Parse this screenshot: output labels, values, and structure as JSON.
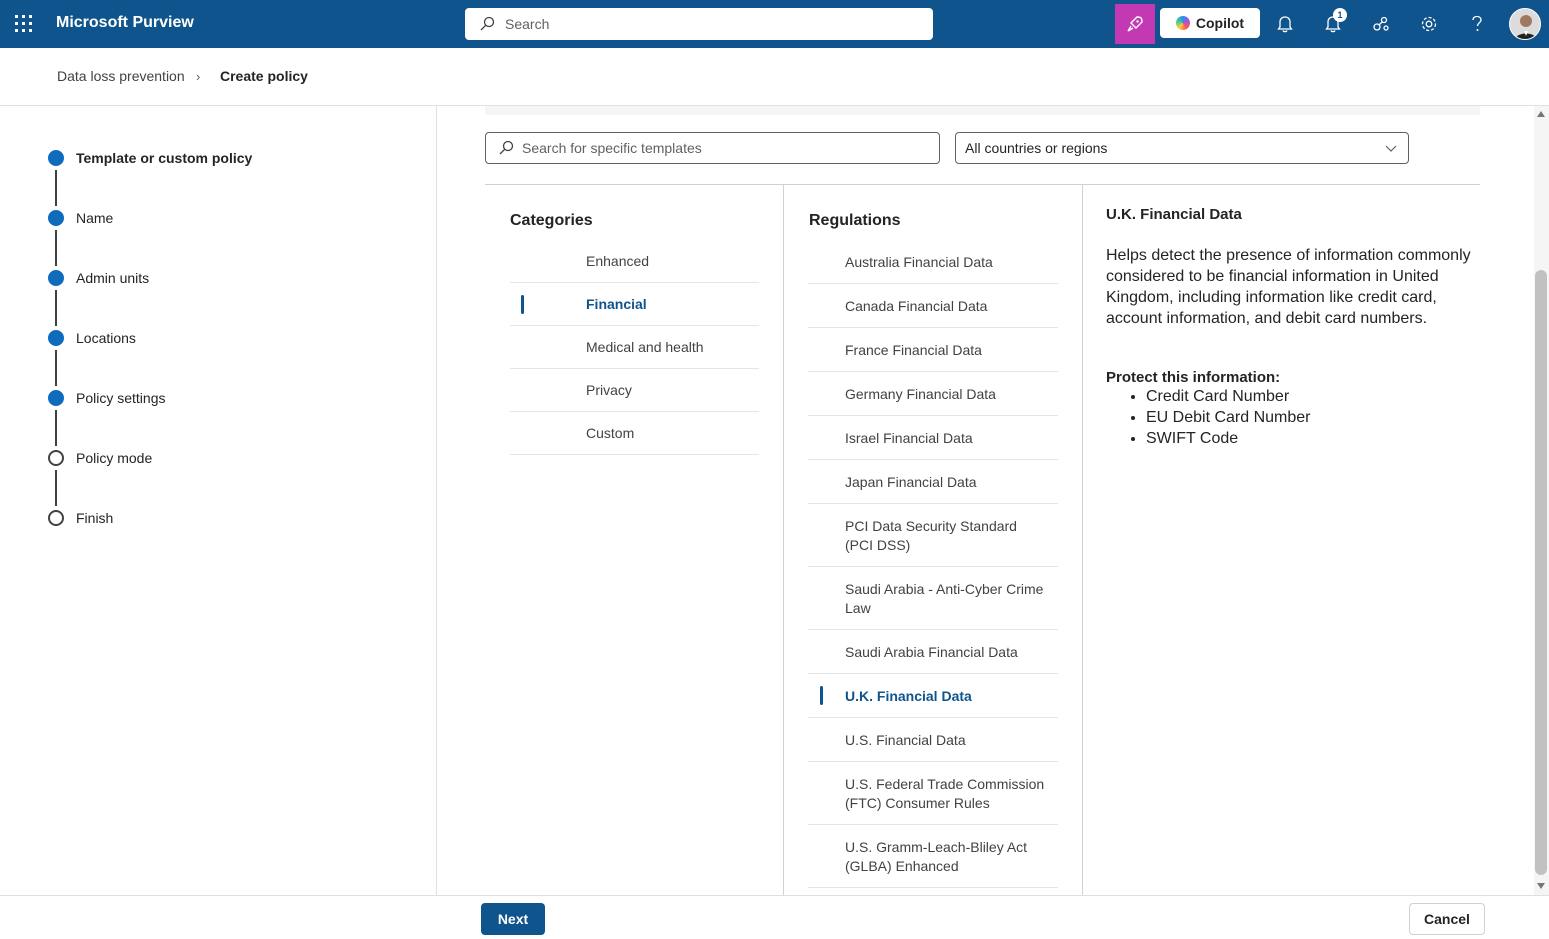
{
  "header": {
    "app_name": "Microsoft Purview",
    "search_placeholder": "Search",
    "copilot_label": "Copilot",
    "notification_count": "1"
  },
  "breadcrumb": {
    "parent": "Data loss prevention",
    "current": "Create policy"
  },
  "steps": [
    {
      "label": "Template or custom policy",
      "state": "current"
    },
    {
      "label": "Name",
      "state": "done"
    },
    {
      "label": "Admin units",
      "state": "done"
    },
    {
      "label": "Locations",
      "state": "done"
    },
    {
      "label": "Policy settings",
      "state": "done"
    },
    {
      "label": "Policy mode",
      "state": "pending"
    },
    {
      "label": "Finish",
      "state": "pending"
    }
  ],
  "filters": {
    "template_search_placeholder": "Search for specific templates",
    "region_selected": "All countries or regions"
  },
  "categories": {
    "heading": "Categories",
    "items": [
      "Enhanced",
      "Financial",
      "Medical and health",
      "Privacy",
      "Custom"
    ],
    "selected": "Financial"
  },
  "regulations": {
    "heading": "Regulations",
    "items": [
      "Australia Financial Data",
      "Canada Financial Data",
      "France Financial Data",
      "Germany Financial Data",
      "Israel Financial Data",
      "Japan Financial Data",
      "PCI Data Security Standard (PCI DSS)",
      "Saudi Arabia - Anti-Cyber Crime Law",
      "Saudi Arabia Financial Data",
      "U.K. Financial Data",
      "U.S. Financial Data",
      "U.S. Federal Trade Commission (FTC) Consumer Rules",
      "U.S. Gramm-Leach-Bliley Act (GLBA) Enhanced"
    ],
    "selected": "U.K. Financial Data"
  },
  "detail": {
    "title": "U.K. Financial Data",
    "description": "Helps detect the presence of information commonly considered to be financial information in United Kingdom, including information like credit card, account information, and debit card numbers.",
    "protect_heading": "Protect this information:",
    "protect_items": [
      "Credit Card Number",
      "EU Debit Card Number",
      "SWIFT Code"
    ]
  },
  "footer": {
    "next_label": "Next",
    "cancel_label": "Cancel"
  },
  "colors": {
    "brand": "#0f548c",
    "step_active": "#0f6cbd",
    "copilot_tile": "#c239b3"
  }
}
